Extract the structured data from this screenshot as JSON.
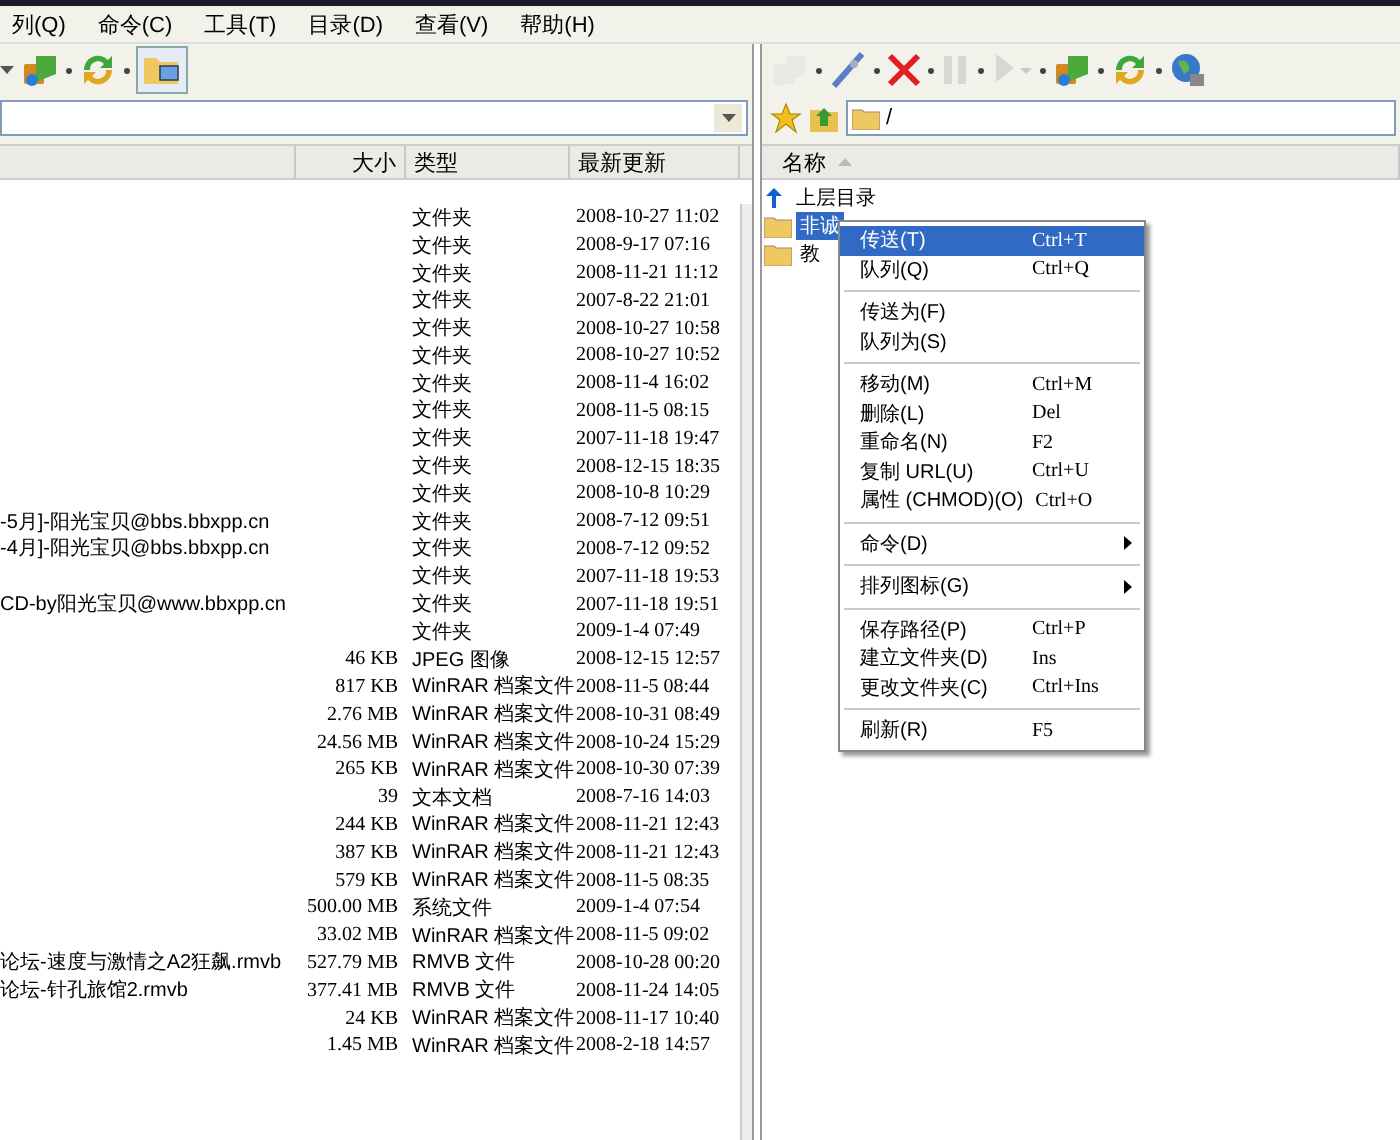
{
  "menubar": [
    "列(Q)",
    "命令(C)",
    "工具(T)",
    "目录(D)",
    "查看(V)",
    "帮助(H)"
  ],
  "left": {
    "toolbar": [
      {
        "kind": "caret",
        "disabled": false
      },
      {
        "kind": "connect",
        "disabled": false
      },
      {
        "kind": "refresh",
        "disabled": false
      },
      {
        "kind": "local",
        "disabled": false,
        "selected": true
      }
    ],
    "columns": [
      "大小",
      "类型",
      "最新更新"
    ],
    "rows": [
      {
        "type": "文件夹",
        "date": "2008-10-27 11:02"
      },
      {
        "type": "文件夹",
        "date": "2008-9-17 07:16"
      },
      {
        "type": "文件夹",
        "date": "2008-11-21 11:12"
      },
      {
        "type": "文件夹",
        "date": "2007-8-22 21:01"
      },
      {
        "type": "文件夹",
        "date": "2008-10-27 10:58"
      },
      {
        "type": "文件夹",
        "date": "2008-10-27 10:52"
      },
      {
        "type": "文件夹",
        "date": "2008-11-4 16:02"
      },
      {
        "type": "文件夹",
        "date": "2008-11-5 08:15"
      },
      {
        "type": "文件夹",
        "date": "2007-11-18 19:47"
      },
      {
        "type": "文件夹",
        "date": "2008-12-15 18:35"
      },
      {
        "type": "文件夹",
        "date": "2008-10-8 10:29"
      },
      {
        "name": "-5月]-阳光宝贝@bbs.bbxpp.cn",
        "type": "文件夹",
        "date": "2008-7-12 09:51"
      },
      {
        "name": "-4月]-阳光宝贝@bbs.bbxpp.cn",
        "type": "文件夹",
        "date": "2008-7-12 09:52"
      },
      {
        "type": "文件夹",
        "date": "2007-11-18 19:53"
      },
      {
        "name": "CD-by阳光宝贝@www.bbxpp.cn",
        "type": "文件夹",
        "date": "2007-11-18 19:51"
      },
      {
        "type": "文件夹",
        "date": "2009-1-4 07:49"
      },
      {
        "size": "46 KB",
        "type": "JPEG 图像",
        "date": "2008-12-15 12:57"
      },
      {
        "size": "817 KB",
        "type": "WinRAR 档案文件",
        "date": "2008-11-5 08:44"
      },
      {
        "size": "2.76 MB",
        "type": "WinRAR 档案文件",
        "date": "2008-10-31 08:49"
      },
      {
        "size": "24.56 MB",
        "type": "WinRAR 档案文件",
        "date": "2008-10-24 15:29"
      },
      {
        "size": "265 KB",
        "type": "WinRAR 档案文件",
        "date": "2008-10-30 07:39"
      },
      {
        "size": "39",
        "type": "文本文档",
        "date": "2008-7-16 14:03"
      },
      {
        "size": "244 KB",
        "type": "WinRAR 档案文件",
        "date": "2008-11-21 12:43"
      },
      {
        "size": "387 KB",
        "type": "WinRAR 档案文件",
        "date": "2008-11-21 12:43"
      },
      {
        "size": "579 KB",
        "type": "WinRAR 档案文件",
        "date": "2008-11-5 08:35"
      },
      {
        "size": "500.00 MB",
        "type": "系统文件",
        "date": "2009-1-4 07:54"
      },
      {
        "size": "33.02 MB",
        "type": "WinRAR 档案文件",
        "date": "2008-11-5 09:02"
      },
      {
        "name": "论坛-速度与激情之A2狂飙.rmvb",
        "size": "527.79 MB",
        "type": "RMVB 文件",
        "date": "2008-10-28 00:20"
      },
      {
        "name": "论坛-针孔旅馆2.rmvb",
        "size": "377.41 MB",
        "type": "RMVB 文件",
        "date": "2008-11-24 14:05"
      },
      {
        "size": "24 KB",
        "type": "WinRAR 档案文件",
        "date": "2008-11-17 10:40"
      },
      {
        "size": "1.45 MB",
        "type": "WinRAR 档案文件",
        "date": "2008-2-18 14:57"
      }
    ]
  },
  "right": {
    "toolbar": [
      {
        "kind": "connect",
        "disabled": true
      },
      {
        "kind": "disconnect",
        "disabled": false
      },
      {
        "kind": "abort",
        "disabled": false
      },
      {
        "kind": "pause",
        "disabled": true
      },
      {
        "kind": "play",
        "disabled": true
      },
      {
        "kind": "connect",
        "disabled": false
      },
      {
        "kind": "refresh",
        "disabled": false
      },
      {
        "kind": "globe",
        "disabled": false
      }
    ],
    "path": "/",
    "column": "名称",
    "rows": [
      {
        "kind": "up",
        "name": "上层目录",
        "selected": false
      },
      {
        "kind": "folder",
        "name": "非诚",
        "selected": true
      },
      {
        "kind": "folder",
        "name": "教",
        "selected": false
      }
    ]
  },
  "context_menu": [
    [
      {
        "label": "传送(T)",
        "shortcut": "Ctrl+T",
        "selected": true,
        "submenu": false
      },
      {
        "label": "队列(Q)",
        "shortcut": "Ctrl+Q",
        "selected": false,
        "submenu": false
      }
    ],
    [
      {
        "label": "传送为(F)",
        "selected": false,
        "submenu": false
      },
      {
        "label": "队列为(S)",
        "selected": false,
        "submenu": false
      }
    ],
    [
      {
        "label": "移动(M)",
        "shortcut": "Ctrl+M",
        "selected": false,
        "submenu": false
      },
      {
        "label": "删除(L)",
        "shortcut": "Del",
        "selected": false,
        "submenu": false
      },
      {
        "label": "重命名(N)",
        "shortcut": "F2",
        "selected": false,
        "submenu": false
      },
      {
        "label": "复制 URL(U)",
        "shortcut": "Ctrl+U",
        "selected": false,
        "submenu": false
      },
      {
        "label": "属性 (CHMOD)(O)",
        "shortcut": "Ctrl+O",
        "selected": false,
        "submenu": false
      }
    ],
    [
      {
        "label": "命令(D)",
        "selected": false,
        "submenu": true
      }
    ],
    [
      {
        "label": "排列图标(G)",
        "selected": false,
        "submenu": true
      }
    ],
    [
      {
        "label": "保存路径(P)",
        "shortcut": "Ctrl+P",
        "selected": false,
        "submenu": false
      },
      {
        "label": "建立文件夹(D)",
        "shortcut": "Ins",
        "selected": false,
        "submenu": false
      },
      {
        "label": "更改文件夹(C)",
        "shortcut": "Ctrl+Ins",
        "selected": false,
        "submenu": false
      }
    ],
    [
      {
        "label": "刷新(R)",
        "shortcut": "F5",
        "selected": false,
        "submenu": false
      }
    ]
  ]
}
